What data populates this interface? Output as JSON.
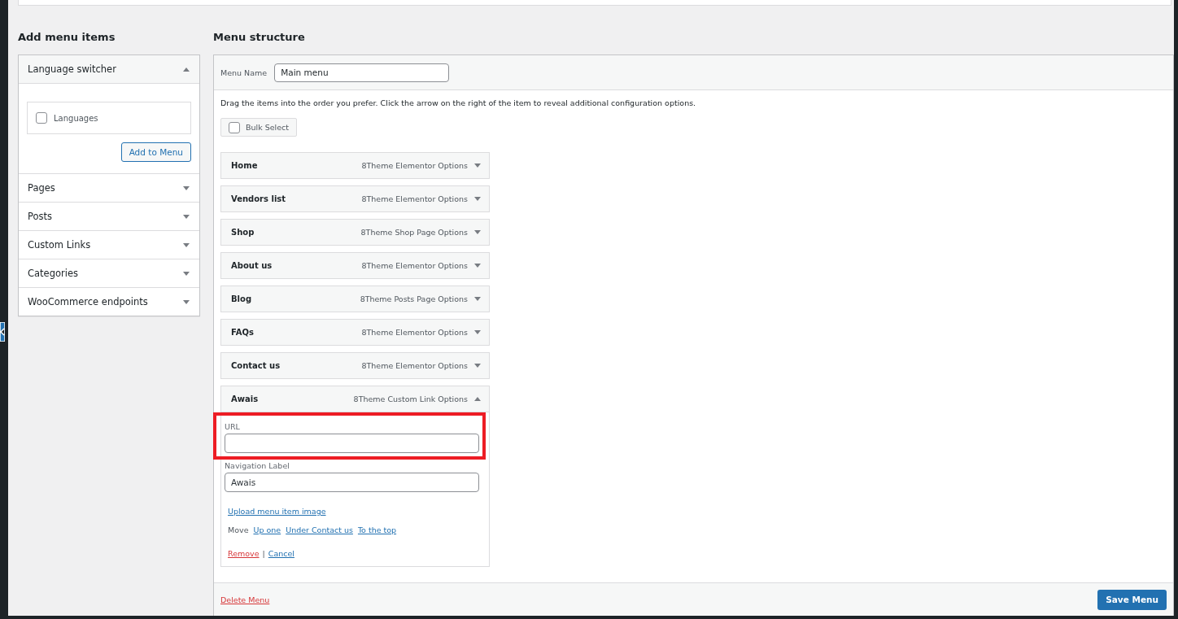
{
  "add_items": {
    "title": "Add menu items",
    "panels": [
      {
        "title": "Language switcher",
        "expanded": true,
        "options": [
          {
            "label": "Languages",
            "checked": false
          }
        ],
        "button": "Add to Menu"
      },
      {
        "title": "Pages",
        "expanded": false
      },
      {
        "title": "Posts",
        "expanded": false
      },
      {
        "title": "Custom Links",
        "expanded": false
      },
      {
        "title": "Categories",
        "expanded": false
      },
      {
        "title": "WooCommerce endpoints",
        "expanded": false
      }
    ]
  },
  "structure": {
    "title": "Menu structure",
    "menu_name": {
      "label": "Menu Name",
      "value": "Main menu"
    },
    "instructions": "Drag the items into the order you prefer. Click the arrow on the right of the item to reveal additional configuration options.",
    "bulk_select": {
      "label": "Bulk Select",
      "checked": false
    },
    "items": [
      {
        "title": "Home",
        "type_label": "8Theme Elementor Options",
        "expanded": false
      },
      {
        "title": "Vendors list",
        "type_label": "8Theme Elementor Options",
        "expanded": false
      },
      {
        "title": "Shop",
        "type_label": "8Theme Shop Page Options",
        "expanded": false
      },
      {
        "title": "About us",
        "type_label": "8Theme Elementor Options",
        "expanded": false
      },
      {
        "title": "Blog",
        "type_label": "8Theme Posts Page Options",
        "expanded": false
      },
      {
        "title": "FAQs",
        "type_label": "8Theme Elementor Options",
        "expanded": false
      },
      {
        "title": "Contact us",
        "type_label": "8Theme Elementor Options",
        "expanded": false
      },
      {
        "title": "Awais",
        "type_label": "8Theme Custom Link Options",
        "expanded": true,
        "fields": [
          {
            "label": "URL",
            "highlighted": true
          },
          {
            "label": "Navigation Label",
            "value": "Awais",
            "highlighted": false
          }
        ],
        "upload_link": "Upload menu item image",
        "move": {
          "label": "Move",
          "links": [
            "Up one",
            "Under Contact us",
            "To the top"
          ]
        },
        "remove": "Remove",
        "separator": "|",
        "cancel": "Cancel"
      }
    ]
  },
  "footer": {
    "delete": "Delete Menu",
    "save": "Save Menu"
  }
}
